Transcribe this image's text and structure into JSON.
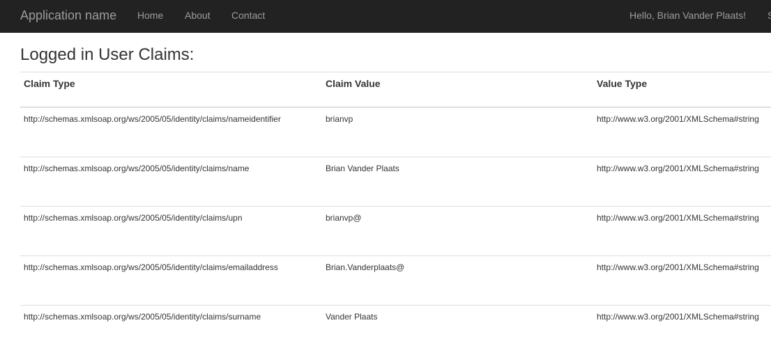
{
  "navbar": {
    "brand": "Application name",
    "links": [
      {
        "label": "Home"
      },
      {
        "label": "About"
      },
      {
        "label": "Contact"
      }
    ],
    "greeting": "Hello, Brian Vander Plaats!",
    "signout_partial": "S"
  },
  "main": {
    "title": "Logged in User Claims:",
    "table": {
      "headers": [
        "Claim Type",
        "Claim Value",
        "Value Type"
      ],
      "rows": [
        [
          "http://schemas.xmlsoap.org/ws/2005/05/identity/claims/nameidentifier",
          "brianvp",
          "http://www.w3.org/2001/XMLSchema#string"
        ],
        [
          "http://schemas.xmlsoap.org/ws/2005/05/identity/claims/name",
          "Brian Vander Plaats",
          "http://www.w3.org/2001/XMLSchema#string"
        ],
        [
          "http://schemas.xmlsoap.org/ws/2005/05/identity/claims/upn",
          "brianvp@",
          "http://www.w3.org/2001/XMLSchema#string"
        ],
        [
          "http://schemas.xmlsoap.org/ws/2005/05/identity/claims/emailaddress",
          "Brian.Vanderplaats@",
          "http://www.w3.org/2001/XMLSchema#string"
        ],
        [
          "http://schemas.xmlsoap.org/ws/2005/05/identity/claims/surname",
          "Vander Plaats",
          "http://www.w3.org/2001/XMLSchema#string"
        ]
      ]
    }
  },
  "colors": {
    "navbar_bg": "#222222",
    "navbar_text": "#9d9d9d",
    "table_border": "#dddddd",
    "text": "#333333"
  }
}
